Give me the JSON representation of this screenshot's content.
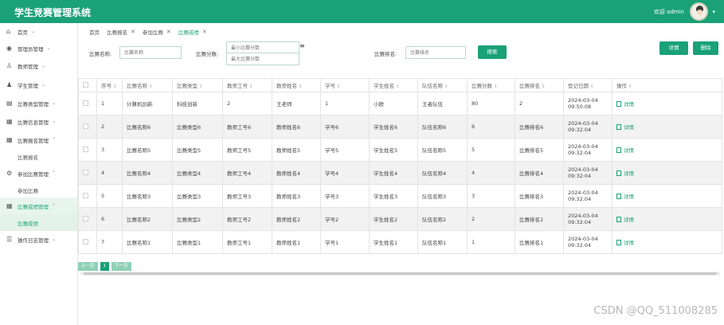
{
  "header": {
    "title": "学生竞赛管理系统",
    "welcome": "欢迎 admin",
    "caret": "▾"
  },
  "sidebar": {
    "items": [
      {
        "label": "首页",
        "icon": "home-icon",
        "glyph": "⌂",
        "chev": "⌄",
        "kind": "group"
      },
      {
        "label": "管理员管理",
        "icon": "admin-icon",
        "glyph": "◉",
        "chev": "⌄",
        "kind": "group"
      },
      {
        "label": "教师管理",
        "icon": "teacher-icon",
        "glyph": "♙",
        "chev": "⌄",
        "kind": "group"
      },
      {
        "label": "学生管理",
        "icon": "student-icon",
        "glyph": "♟",
        "chev": "⌄",
        "kind": "group"
      },
      {
        "label": "比赛类型管理",
        "icon": "list-icon",
        "glyph": "▤",
        "chev": "⌄",
        "kind": "group"
      },
      {
        "label": "比赛信息管理",
        "icon": "grid-icon",
        "glyph": "▦",
        "chev": "⌄",
        "kind": "group"
      },
      {
        "label": "比赛报名管理",
        "icon": "grid-icon",
        "glyph": "▦",
        "chev": "⌃",
        "kind": "group"
      },
      {
        "label": "比赛报名",
        "kind": "sub"
      },
      {
        "label": "参加比赛管理",
        "icon": "gear-icon",
        "glyph": "⚙",
        "chev": "⌃",
        "kind": "group"
      },
      {
        "label": "参加比赛",
        "kind": "sub"
      },
      {
        "label": "比赛成绩管理",
        "icon": "grid-icon",
        "glyph": "▦",
        "chev": "⌃",
        "kind": "active-group"
      },
      {
        "label": "比赛成绩",
        "kind": "active-sub"
      },
      {
        "label": "操作日志管理",
        "icon": "log-icon",
        "glyph": "☰",
        "chev": "⌄",
        "kind": "group"
      }
    ]
  },
  "tabs": [
    {
      "label": "首页",
      "closable": false,
      "active": false
    },
    {
      "label": "比赛报名",
      "closable": true,
      "active": false
    },
    {
      "label": "参加比赛",
      "closable": true,
      "active": false
    },
    {
      "label": "比赛成绩",
      "closable": true,
      "active": true
    }
  ],
  "tab_close_glyph": "✕",
  "search": {
    "name_label": "比赛名称:",
    "name_placeholder": "比赛名称",
    "score_label": "比赛分数:",
    "score_min_placeholder": "最小比赛分数",
    "score_max_placeholder": "最大比赛分数",
    "rank_label": "比赛排名:",
    "rank_placeholder": "比赛排名",
    "search_button": "搜索",
    "detail_button": "详情",
    "delete_button": "删除"
  },
  "table": {
    "sort_glyph": "⇕",
    "columns": [
      "序号",
      "比赛名称",
      "比赛类型",
      "教师工号",
      "教师姓名",
      "学号",
      "学生姓名",
      "队伍名称",
      "比赛分数",
      "比赛排名",
      "登记日期",
      "操作"
    ],
    "detail_label": "详情",
    "rows": [
      [
        "1",
        "计算机创新",
        "科技创新",
        "2",
        "王老师",
        "1",
        "小欧",
        "王者队伍",
        "80",
        "2",
        "2024-03-04 09:50:08"
      ],
      [
        "2",
        "比赛名称6",
        "比赛类型6",
        "教师工号6",
        "教师姓名6",
        "学号6",
        "学生姓名6",
        "队伍名称6",
        "6",
        "比赛排名6",
        "2024-03-04 09:32:04"
      ],
      [
        "3",
        "比赛名称5",
        "比赛类型5",
        "教师工号5",
        "教师姓名5",
        "学号5",
        "学生姓名5",
        "队伍名称5",
        "5",
        "比赛排名5",
        "2024-03-04 09:32:04"
      ],
      [
        "4",
        "比赛名称4",
        "比赛类型4",
        "教师工号4",
        "教师姓名4",
        "学号4",
        "学生姓名4",
        "队伍名称4",
        "4",
        "比赛排名4",
        "2024-03-04 09:32:04"
      ],
      [
        "5",
        "比赛名称3",
        "比赛类型3",
        "教师工号3",
        "教师姓名3",
        "学号3",
        "学生姓名3",
        "队伍名称3",
        "3",
        "比赛排名3",
        "2024-03-04 09:32:04"
      ],
      [
        "6",
        "比赛名称2",
        "比赛类型2",
        "教师工号2",
        "教师姓名2",
        "学号2",
        "学生姓名2",
        "队伍名称2",
        "2",
        "比赛排名2",
        "2024-03-04 09:32:04"
      ],
      [
        "7",
        "比赛名称1",
        "比赛类型1",
        "教师工号1",
        "教师姓名1",
        "学号1",
        "学生姓名1",
        "队伍名称1",
        "1",
        "比赛排名1",
        "2024-03-04 09:32:04"
      ]
    ]
  },
  "pager": {
    "prev": "上一页",
    "current": "1",
    "next": "下一页"
  },
  "watermark": "CSDN @QQ_511008285",
  "colors": {
    "accent": "#1aa176"
  }
}
